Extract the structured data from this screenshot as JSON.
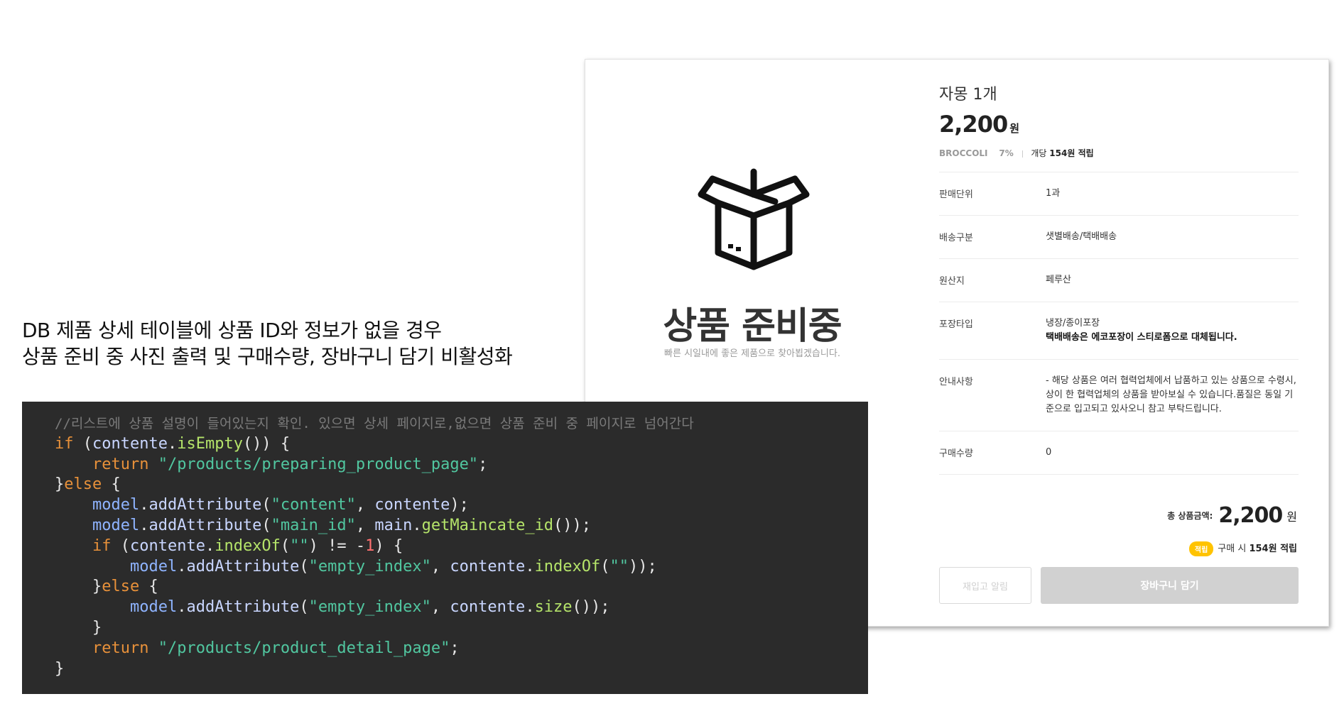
{
  "caption": {
    "line1": "DB 제품 상세 테이블에 상품 ID와 정보가 없을 경우",
    "line2": "상품 준비 중 사진 출력 및 구매수량, 장바구니 담기 비활성화"
  },
  "product": {
    "preparing_title": "상품 준비중",
    "preparing_sub": "빠른 시일내에 좋은 제품으로 찾아뵙겠습니다.",
    "name": "자몽 1개",
    "price": "2,200",
    "price_unit": "원",
    "brand": "BROCCOLI",
    "percent": "7%",
    "point_prefix": "개당",
    "point_value": "154원 적립",
    "rows": [
      {
        "key": "판매단위",
        "value": "1과"
      },
      {
        "key": "배송구분",
        "value": "샛별배송/택배배송"
      },
      {
        "key": "원산지",
        "value": "페루산"
      },
      {
        "key": "포장타입",
        "value": "냉장/종이포장",
        "value_bold": "택배배송은 에코포장이 스티로폼으로 대체됩니다."
      },
      {
        "key": "안내사항",
        "value": "- 해당 상품은 여러 협력업체에서 납품하고 있는 상품으로 수령시, 상이 한 협력업체의 상품을 받아보실 수 있습니다.품질은 동일 기준으로 입고되고 있사오니 참고 부탁드립니다."
      },
      {
        "key": "구매수량",
        "value": "0"
      }
    ],
    "total_label": "총 상품금액:",
    "total_value": "2,200",
    "total_unit": "원",
    "badge": "적립",
    "purchase_point_prefix": "구매 시",
    "purchase_point_value": "154원 적립",
    "alarm_button": "재입고 알림",
    "cart_button": "장바구니 담기"
  },
  "code": {
    "comment": "//리스트에 상품 설명이 들어있는지 확인. 있으면 상세 페이지로,없으면 상품 준비 중 페이지로 넘어간다"
  },
  "colors": {
    "code_bg": "#2b2b2b",
    "point_badge": "#ffc300",
    "disabled_button": "#d1d1d1"
  }
}
